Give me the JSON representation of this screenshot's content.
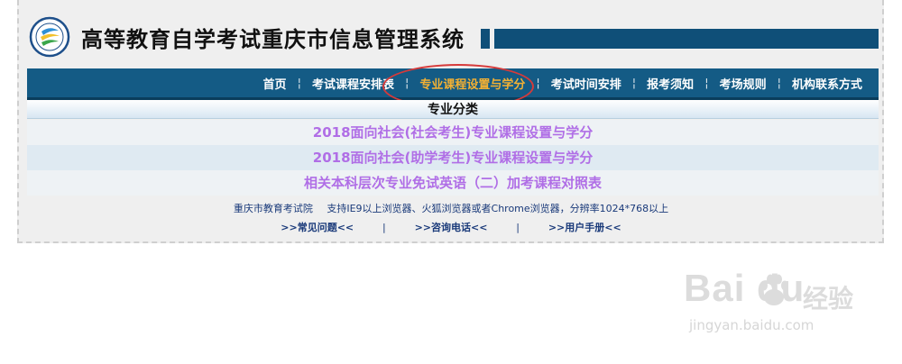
{
  "header": {
    "title": "高等教育自学考试重庆市信息管理系统",
    "accent_color": "#0f4f78"
  },
  "nav": {
    "items": [
      {
        "label": "首页"
      },
      {
        "label": "考试课程安排表"
      },
      {
        "label": "专业课程设置与学分",
        "active": true
      },
      {
        "label": "考试时间安排"
      },
      {
        "label": "报考须知"
      },
      {
        "label": "考场规则"
      },
      {
        "label": "机构联系方式"
      }
    ],
    "active_color": "#f4b133",
    "background": "#145b85"
  },
  "section": {
    "title": "专业分类"
  },
  "links": [
    "2018面向社会(社会考生)专业课程设置与学分",
    "2018面向社会(助学考生)专业课程设置与学分",
    "相关本科层次专业免试英语（二）加考课程对照表"
  ],
  "footer": {
    "org": "重庆市教育考试院",
    "browser_note": "支持IE9以上浏览器、火狐浏览器或者Chrome浏览器，分辨率1024*768以上",
    "faq": ">>常见问题<<",
    "hotline": ">>咨询电话<<",
    "manual": ">>用户手册<<",
    "separator": "|"
  },
  "watermark": {
    "brand": "Bai  du",
    "cn": "经验",
    "url": "jingyan.baidu.com"
  }
}
